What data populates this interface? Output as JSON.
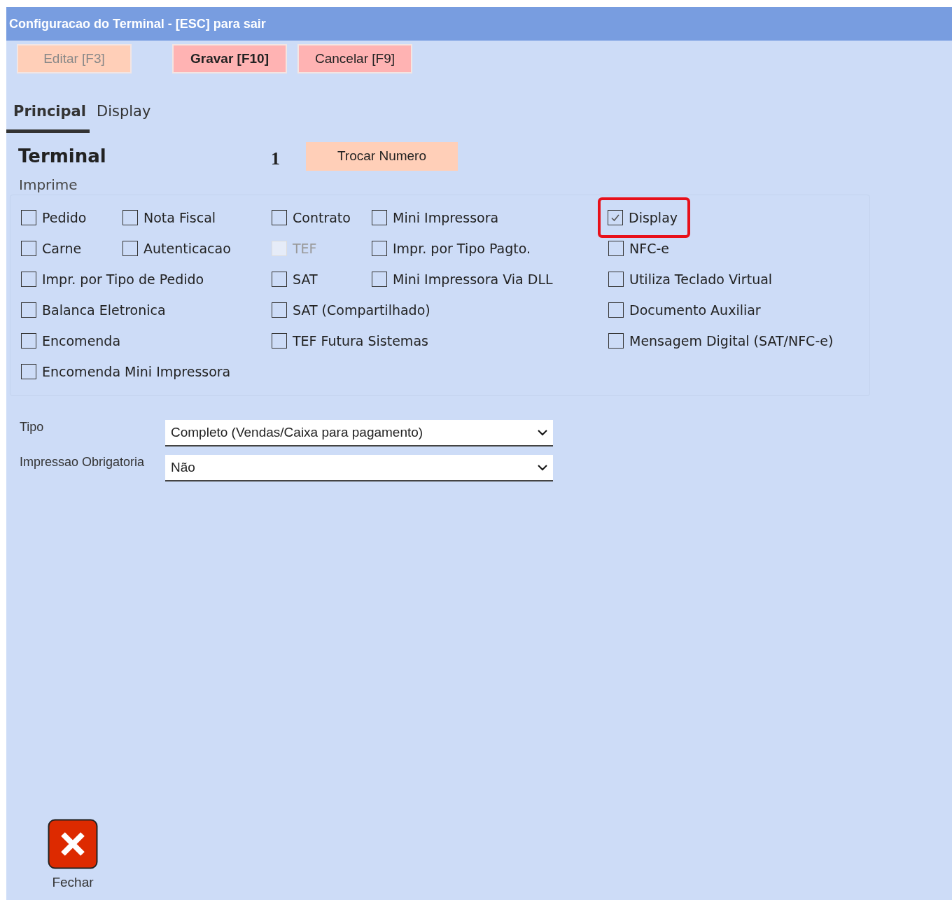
{
  "window": {
    "title": "Configuracao do Terminal - [ESC] para sair"
  },
  "toolbar": [
    {
      "label": "Editar [F3]",
      "kind": "disabled"
    },
    {
      "label": "Gravar [F10]",
      "kind": "primary"
    },
    {
      "label": "Cancelar [F9]",
      "kind": "normal"
    }
  ],
  "tabs": [
    {
      "label": "Principal",
      "selected": true
    },
    {
      "label": "Display",
      "selected": false
    }
  ],
  "terminal": {
    "label": "Terminal",
    "number": "1",
    "button": "Trocar Numero"
  },
  "imprime": {
    "title": "Imprime",
    "groups": [
      [
        [
          {
            "label": "Pedido",
            "checked": false,
            "disabled": false,
            "highlighted": false
          },
          {
            "label": "Nota Fiscal",
            "checked": false,
            "disabled": false,
            "highlighted": false
          }
        ],
        [
          {
            "label": "Carne",
            "checked": false,
            "disabled": false,
            "highlighted": false
          },
          {
            "label": "Autenticacao",
            "checked": false,
            "disabled": false,
            "highlighted": false
          }
        ],
        [
          {
            "label": "Impr. por Tipo de Pedido",
            "checked": false,
            "disabled": false,
            "highlighted": false
          }
        ],
        [
          {
            "label": "Balanca Eletronica",
            "checked": false,
            "disabled": false,
            "highlighted": false
          }
        ],
        [
          {
            "label": "Encomenda",
            "checked": false,
            "disabled": false,
            "highlighted": false
          }
        ],
        [
          {
            "label": "Encomenda Mini Impressora",
            "checked": false,
            "disabled": false,
            "highlighted": false
          }
        ]
      ],
      [
        [
          {
            "label": "Contrato",
            "checked": false,
            "disabled": false,
            "highlighted": false
          },
          {
            "label": "Mini Impressora",
            "checked": false,
            "disabled": false,
            "highlighted": false
          }
        ],
        [
          {
            "label": "TEF",
            "checked": false,
            "disabled": true,
            "highlighted": false
          },
          {
            "label": "Impr. por Tipo Pagto.",
            "checked": false,
            "disabled": false,
            "highlighted": false
          }
        ],
        [
          {
            "label": "SAT",
            "checked": false,
            "disabled": false,
            "highlighted": false
          },
          {
            "label": "Mini Impressora Via DLL",
            "checked": false,
            "disabled": false,
            "highlighted": false
          }
        ],
        [
          {
            "label": "SAT (Compartilhado)",
            "checked": false,
            "disabled": false,
            "highlighted": false
          }
        ],
        [
          {
            "label": "TEF Futura Sistemas",
            "checked": false,
            "disabled": false,
            "highlighted": false
          }
        ]
      ],
      [
        [
          {
            "label": "Display",
            "checked": true,
            "disabled": false,
            "highlighted": true
          }
        ],
        [
          {
            "label": "NFC-e",
            "checked": false,
            "disabled": false,
            "highlighted": false
          }
        ],
        [
          {
            "label": "Utiliza Teclado Virtual",
            "checked": false,
            "disabled": false,
            "highlighted": false
          }
        ],
        [
          {
            "label": "Documento Auxiliar",
            "checked": false,
            "disabled": false,
            "highlighted": false
          }
        ],
        [
          {
            "label": "Mensagem Digital (SAT/NFC-e)",
            "checked": false,
            "disabled": false,
            "highlighted": false
          }
        ]
      ]
    ]
  },
  "fields": [
    {
      "label": "Tipo",
      "value": "Completo (Vendas/Caixa para pagamento)"
    },
    {
      "label": "Impressao Obrigatoria",
      "value": "Não"
    }
  ],
  "close": {
    "label": "Fechar"
  }
}
